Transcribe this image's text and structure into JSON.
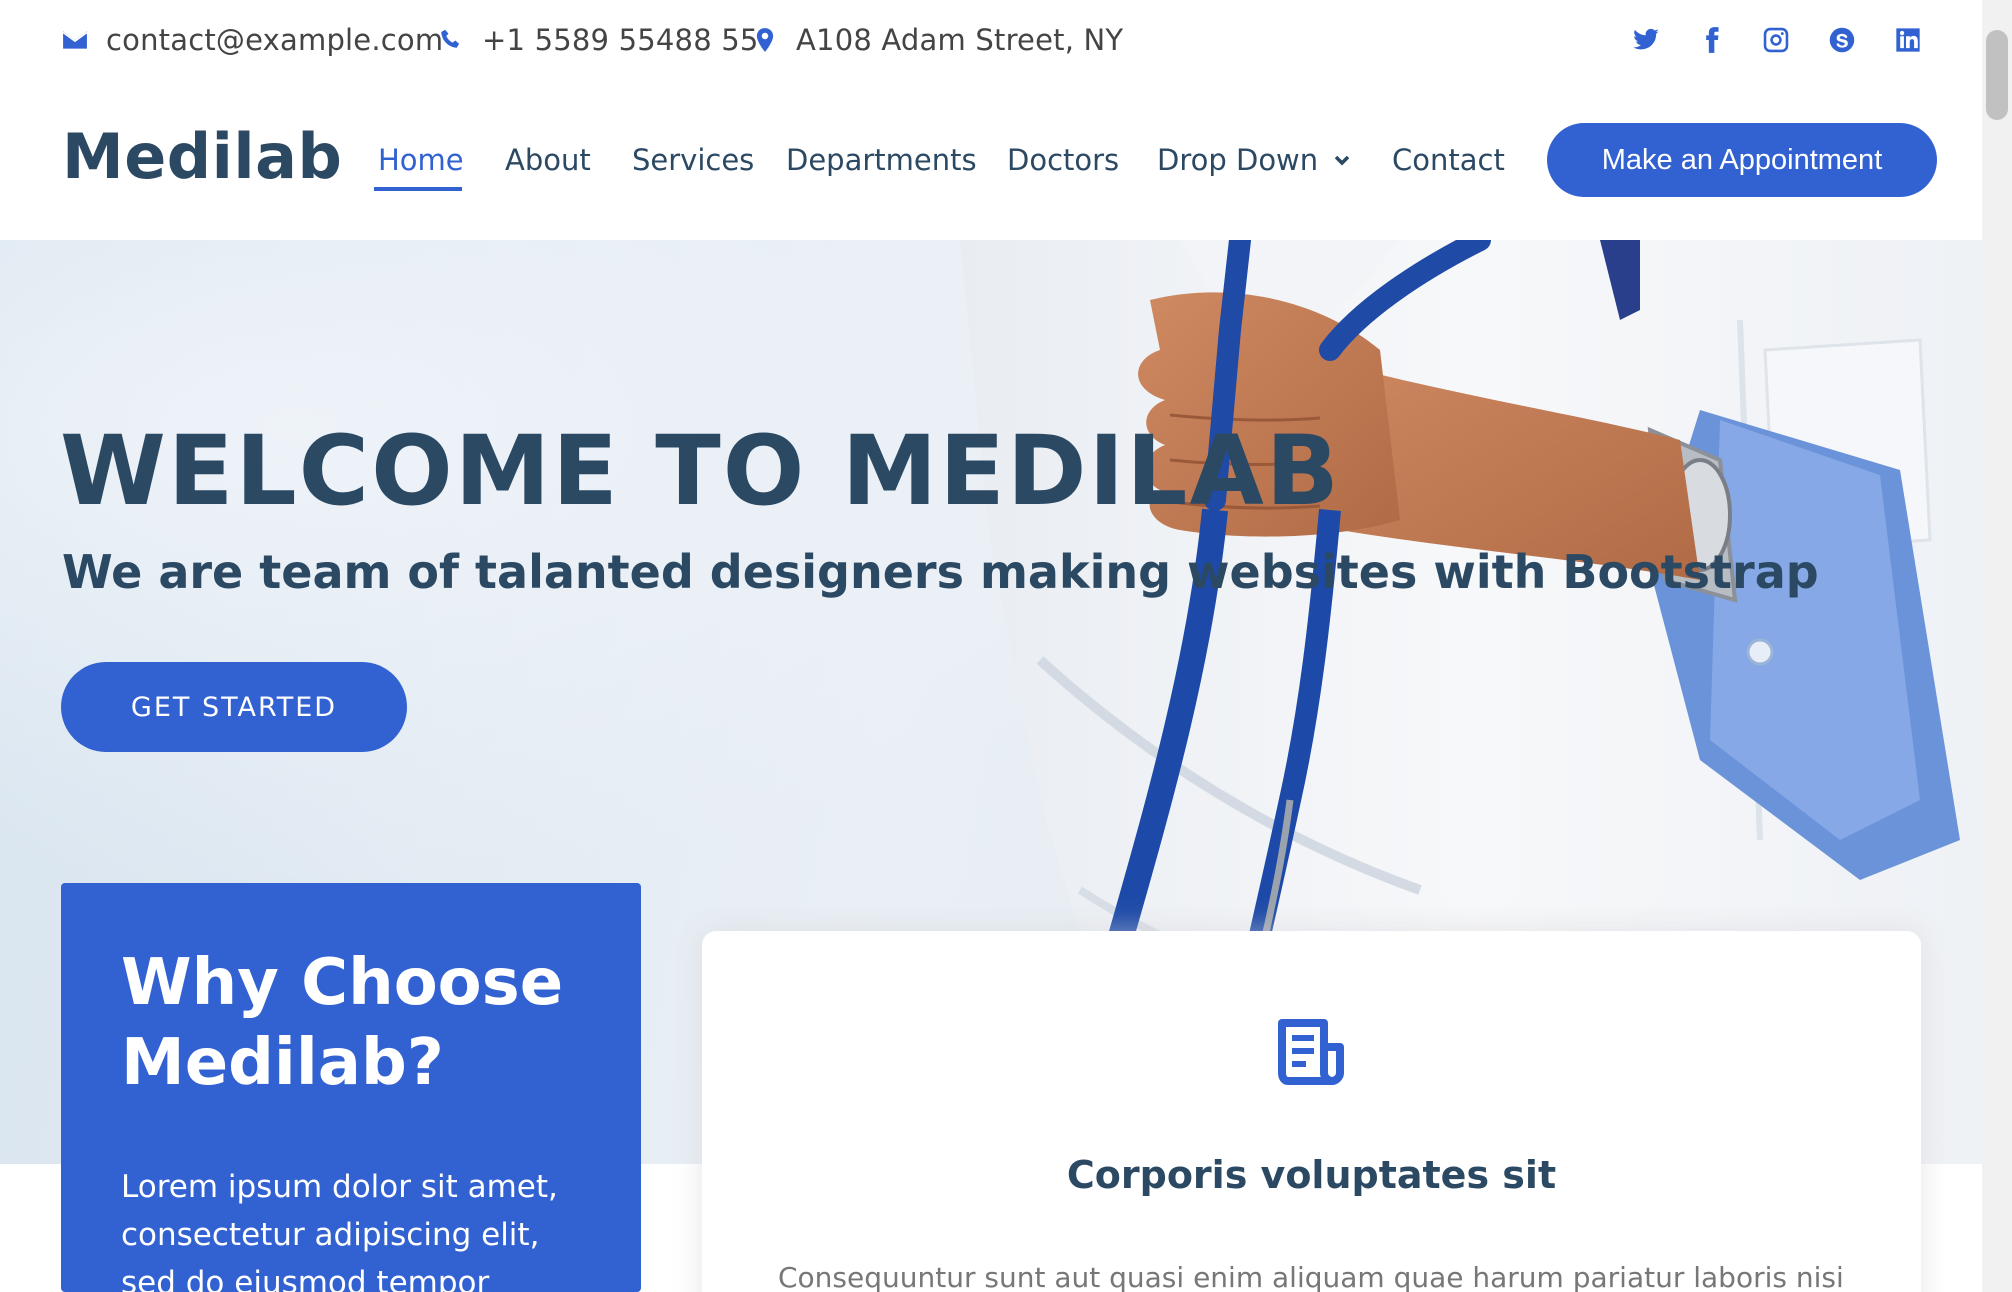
{
  "topbar": {
    "email": "contact@example.com",
    "phone": "+1 5589 55488 55",
    "address": "A108 Adam Street, NY",
    "social": [
      "twitter-icon",
      "facebook-icon",
      "instagram-icon",
      "skype-icon",
      "linkedin-icon"
    ]
  },
  "header": {
    "logo": "Medilab",
    "nav": [
      {
        "label": "Home",
        "active": true
      },
      {
        "label": "About"
      },
      {
        "label": "Services"
      },
      {
        "label": "Departments"
      },
      {
        "label": "Doctors"
      },
      {
        "label": "Drop Down",
        "has_dropdown": true
      },
      {
        "label": "Contact"
      }
    ],
    "cta_label": "Make an Appointment"
  },
  "hero": {
    "title": "WELCOME TO MEDILAB",
    "subtitle": "We are team of talanted designers making websites with Bootstrap",
    "button_label": "GET STARTED"
  },
  "why": {
    "title": "Why Choose Medilab?",
    "text": "Lorem ipsum dolor sit amet, consectetur adipiscing elit, sed do eiusmod tempor incididunt"
  },
  "card": {
    "icon": "receipt-icon",
    "title": "Corporis voluptates sit",
    "text": "Consequuntur sunt aut quasi enim aliquam quae harum pariatur laboris nisi"
  },
  "colors": {
    "accent": "#3262d2",
    "heading": "#2c4964",
    "text": "#444444",
    "muted": "#777777"
  }
}
